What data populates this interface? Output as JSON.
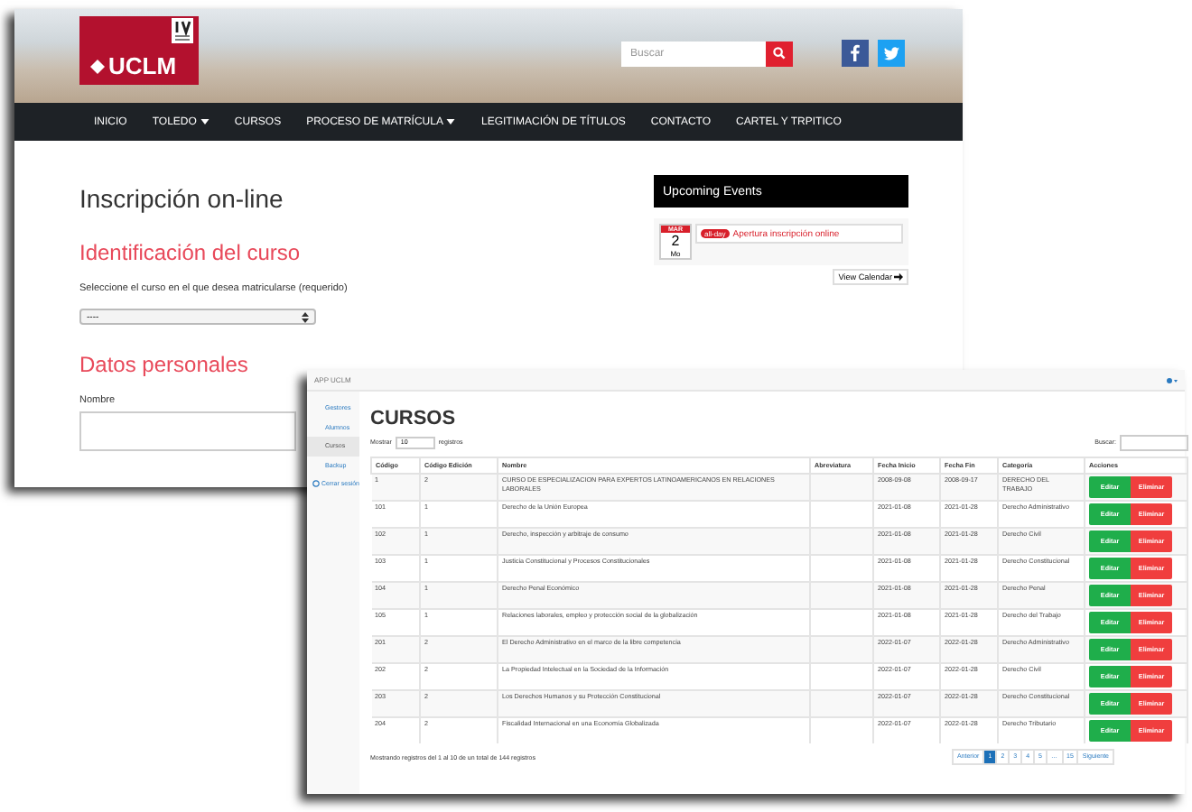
{
  "site": {
    "logo_text": "UCLM",
    "search": {
      "placeholder": "Buscar"
    },
    "nav": [
      {
        "label": "INICIO",
        "dropdown": false
      },
      {
        "label": "TOLEDO",
        "dropdown": true
      },
      {
        "label": "CURSOS",
        "dropdown": false
      },
      {
        "label": "PROCESO DE MATRÍCULA",
        "dropdown": true
      },
      {
        "label": "LEGITIMACIÓN DE TÍTULOS",
        "dropdown": false
      },
      {
        "label": "CONTACTO",
        "dropdown": false
      },
      {
        "label": "CARTEL Y TRPITICO",
        "dropdown": false
      }
    ],
    "page_title": "Inscripción on-line",
    "course_section": {
      "heading": "Identificación del curso",
      "select_label": "Seleccione el curso en el que desea matricularse (requerido)",
      "select_value": "----"
    },
    "personal_section": {
      "heading": "Datos personales",
      "field_label": "Nombre"
    },
    "events": {
      "title": "Upcoming Events",
      "items": [
        {
          "month": "MAR",
          "day": "2",
          "weekday": "Mo",
          "badge": "all-day",
          "title": "Apertura inscripción online"
        }
      ],
      "calendar_button": "View Calendar"
    }
  },
  "app": {
    "title": "APP UCLM",
    "sidebar": [
      {
        "label": "Gestores",
        "kind": "link",
        "selected": false
      },
      {
        "label": "Alumnos",
        "kind": "link",
        "selected": false
      },
      {
        "label": "Cursos",
        "kind": "link",
        "selected": true
      },
      {
        "label": "Backup",
        "kind": "link",
        "selected": false
      },
      {
        "label": "Cerrar sesión",
        "kind": "logout",
        "selected": false
      }
    ],
    "heading": "CURSOS",
    "length": {
      "before": "Mostrar",
      "value": "10",
      "after": "registros"
    },
    "search_label": "Buscar:",
    "columns": [
      "Código",
      "Código Edición",
      "Nombre",
      "Abreviatura",
      "Fecha Inicio",
      "Fecha Fin",
      "Categoría",
      "Acciones"
    ],
    "rows": [
      {
        "cells": [
          "1",
          "2",
          "CURSO DE ESPECIALIZACION PARA EXPERTOS LATINOAMERICANOS EN RELACIONES LABORALES",
          "",
          "2008-09-08",
          "2008-09-17",
          "DERECHO DEL TRABAJO"
        ],
        "actions": [
          "Editar",
          "Eliminar"
        ]
      },
      {
        "cells": [
          "101",
          "1",
          "Derecho de la Unión Europea",
          "",
          "2021-01-08",
          "2021-01-28",
          "Derecho Administrativo"
        ],
        "actions": [
          "Editar",
          "Eliminar"
        ]
      },
      {
        "cells": [
          "102",
          "1",
          "Derecho, inspección y arbitraje de consumo",
          "",
          "2021-01-08",
          "2021-01-28",
          "Derecho Civil"
        ],
        "actions": [
          "Editar",
          "Eliminar"
        ]
      },
      {
        "cells": [
          "103",
          "1",
          "Justicia Constitucional y Procesos Constitucionales",
          "",
          "2021-01-08",
          "2021-01-28",
          "Derecho Constitucional"
        ],
        "actions": [
          "Editar",
          "Eliminar"
        ]
      },
      {
        "cells": [
          "104",
          "1",
          "Derecho Penal Económico",
          "",
          "2021-01-08",
          "2021-01-28",
          "Derecho Penal"
        ],
        "actions": [
          "Editar",
          "Eliminar"
        ]
      },
      {
        "cells": [
          "105",
          "1",
          "Relaciones laborales, empleo y protección social de la globalización",
          "",
          "2021-01-08",
          "2021-01-28",
          "Derecho del Trabajo"
        ],
        "actions": [
          "Editar",
          "Eliminar"
        ]
      },
      {
        "cells": [
          "201",
          "2",
          "El Derecho Administrativo en el marco de la libre competencia",
          "",
          "2022-01-07",
          "2022-01-28",
          "Derecho Administrativo"
        ],
        "actions": [
          "Editar",
          "Eliminar"
        ]
      },
      {
        "cells": [
          "202",
          "2",
          "La Propiedad Intelectual en la Sociedad de la Información",
          "",
          "2022-01-07",
          "2022-01-28",
          "Derecho Civil"
        ],
        "actions": [
          "Editar",
          "Eliminar"
        ]
      },
      {
        "cells": [
          "203",
          "2",
          "Los Derechos Humanos y su Protección Constitucional",
          "",
          "2022-01-07",
          "2022-01-28",
          "Derecho Constitucional"
        ],
        "actions": [
          "Editar",
          "Eliminar"
        ]
      },
      {
        "cells": [
          "204",
          "2",
          "Fiscalidad Internacional en una Economía Globalizada",
          "",
          "2022-01-07",
          "2022-01-28",
          "Derecho Tributario"
        ],
        "actions": [
          "Editar",
          "Eliminar"
        ]
      }
    ],
    "info": "Mostrando registros del 1 al 10 de un total de 144 registros",
    "pagination": [
      {
        "label": "Anterior",
        "selected": false
      },
      {
        "label": "1",
        "selected": true
      },
      {
        "label": "2",
        "selected": false
      },
      {
        "label": "3",
        "selected": false
      },
      {
        "label": "4",
        "selected": false
      },
      {
        "label": "5",
        "selected": false
      },
      {
        "label": "…",
        "selected": false
      },
      {
        "label": "15",
        "selected": false
      },
      {
        "label": "Siguiente",
        "selected": false
      }
    ]
  }
}
